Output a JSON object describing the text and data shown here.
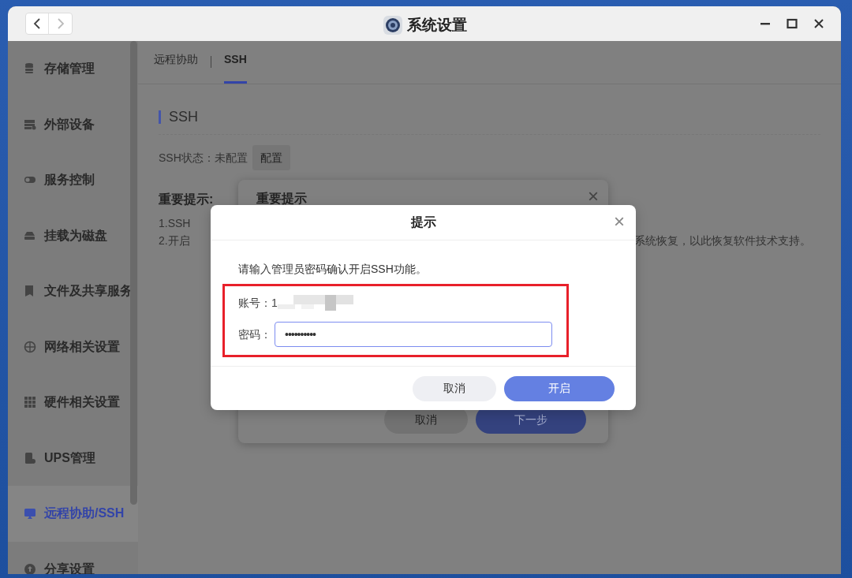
{
  "window": {
    "title": "系统设置"
  },
  "sidebar": {
    "items": [
      {
        "label": "存储管理",
        "selected": false
      },
      {
        "label": "外部设备",
        "selected": false
      },
      {
        "label": "服务控制",
        "selected": false
      },
      {
        "label": "挂载为磁盘",
        "selected": false
      },
      {
        "label": "文件及共享服务",
        "selected": false
      },
      {
        "label": "网络相关设置",
        "selected": false
      },
      {
        "label": "硬件相关设置",
        "selected": false
      },
      {
        "label": "UPS管理",
        "selected": false
      },
      {
        "label": "远程协助/SSH",
        "selected": true
      },
      {
        "label": "分享设置",
        "selected": false
      }
    ]
  },
  "tabs": [
    {
      "label": "远程协助",
      "selected": false
    },
    {
      "label": "SSH",
      "selected": true
    }
  ],
  "section": {
    "title": "SSH",
    "status_label": "SSH状态：未配置",
    "configure_button": "配置",
    "notes_title": "重要提示:",
    "note_1": "1.SSH",
    "note_2_start": "2.开启",
    "note_2_end": "系统恢复，以此恢复软件技术支持。"
  },
  "back_dialog": {
    "title": "重要提示",
    "close": "×",
    "buttons": [
      "取消",
      "下一步"
    ]
  },
  "dialog": {
    "title": "提示",
    "close": "×",
    "message": "请输入管理员密码确认开启SSH功能。",
    "account_label": "账号：",
    "account_value": "1",
    "password_label": "密码：",
    "password_value": "••••••••••",
    "buttons": [
      {
        "label": "取消",
        "kind": "secondary"
      },
      {
        "label": "开启",
        "kind": "primary"
      }
    ]
  }
}
